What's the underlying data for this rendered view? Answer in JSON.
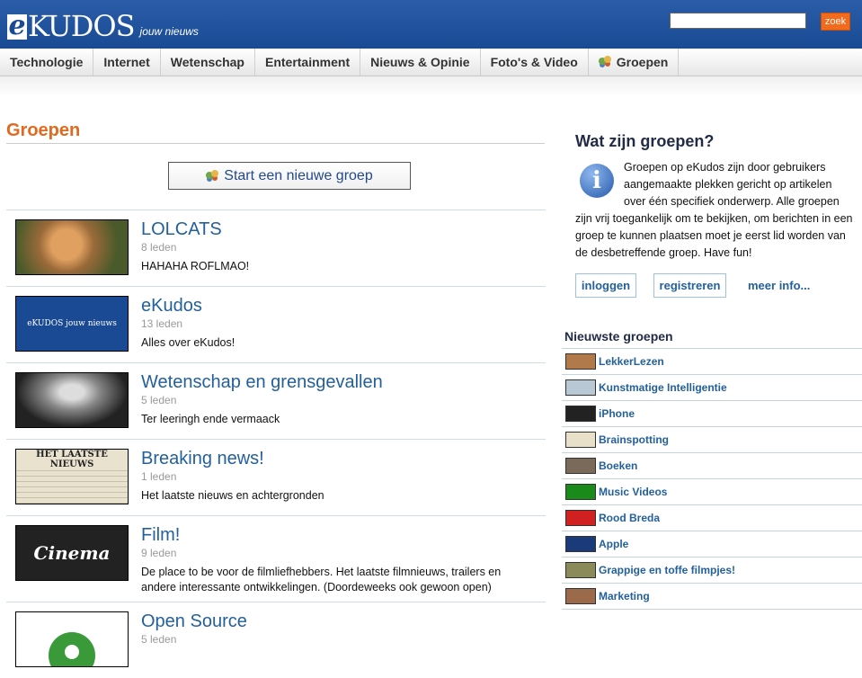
{
  "header": {
    "logo_e": "e",
    "logo_kudos": "KUDOS",
    "tagline": "jouw nieuws",
    "search_button": "zoek",
    "search_value": ""
  },
  "nav": {
    "items": [
      {
        "label": "Technologie"
      },
      {
        "label": "Internet"
      },
      {
        "label": "Wetenschap"
      },
      {
        "label": "Entertainment"
      },
      {
        "label": "Nieuws & Opinie"
      },
      {
        "label": "Foto's & Video"
      },
      {
        "label": "Groepen",
        "icon": "group-icon"
      }
    ]
  },
  "main": {
    "title": "Groepen",
    "start_button": "Start een nieuwe groep",
    "groups": [
      {
        "name": "LOLCATS",
        "members": "8 leden",
        "description": "HAHAHA ROFLMAO!",
        "thumb_color": "#9a6a3a"
      },
      {
        "name": "eKudos",
        "members": "13 leden",
        "description": "Alles over eKudos!",
        "thumb_color": "#1a4a94",
        "thumb_text": "eKUDOS jouw nieuws"
      },
      {
        "name": "Wetenschap en grensgevallen",
        "members": "5 leden",
        "description": "Ter leeringh ende vermaack",
        "thumb_color": "#777777"
      },
      {
        "name": "Breaking news!",
        "members": "1 leden",
        "description": "Het laatste nieuws en achtergronden",
        "thumb_color": "#e8e2cf",
        "thumb_text": "HET LAATSTE NIEUWS"
      },
      {
        "name": "Film!",
        "members": "9 leden",
        "description": "De place to be voor de filmliefhebbers. Het laatste filmnieuws, trailers en andere interessante ontwikkelingen. (Doordeweeks ook gewoon open)",
        "thumb_color": "#222222",
        "thumb_text": "Cinema"
      },
      {
        "name": "Open Source",
        "members": "5 leden",
        "description": "",
        "thumb_color": "#3a9a3a"
      }
    ]
  },
  "sidebar": {
    "title": "Wat zijn groepen?",
    "info_icon": "info-icon",
    "info_letter": "i",
    "info_text_1": "Groepen op eKudos zijn door gebruikers aangemaakte plekken gericht op artikelen over één specifiek onderwerp. Alle groepen",
    "info_text_2": "zijn vrij toegankelijk om te bekijken, om berichten in een groep te kunnen plaatsen moet je eerst lid worden van de desbetreffende groep. Have fun!",
    "login": "inloggen",
    "register": "registreren",
    "more_info": "meer info...",
    "newest_title": "Nieuwste groepen",
    "newest": [
      {
        "label": "LekkerLezen",
        "color": "#b07a4a"
      },
      {
        "label": "Kunstmatige Intelligentie",
        "color": "#b8c8d4"
      },
      {
        "label": "iPhone",
        "color": "#222222"
      },
      {
        "label": "Brainspotting",
        "color": "#e8e0c8"
      },
      {
        "label": "Boeken",
        "color": "#7a6a5a"
      },
      {
        "label": "Music Videos",
        "color": "#1a8a1a"
      },
      {
        "label": "Rood Breda",
        "color": "#d02020"
      },
      {
        "label": "Apple",
        "color": "#1a3a7a"
      },
      {
        "label": "Grappige en toffe filmpjes!",
        "color": "#8a8a5a"
      },
      {
        "label": "Marketing",
        "color": "#9a6a4a"
      }
    ]
  }
}
